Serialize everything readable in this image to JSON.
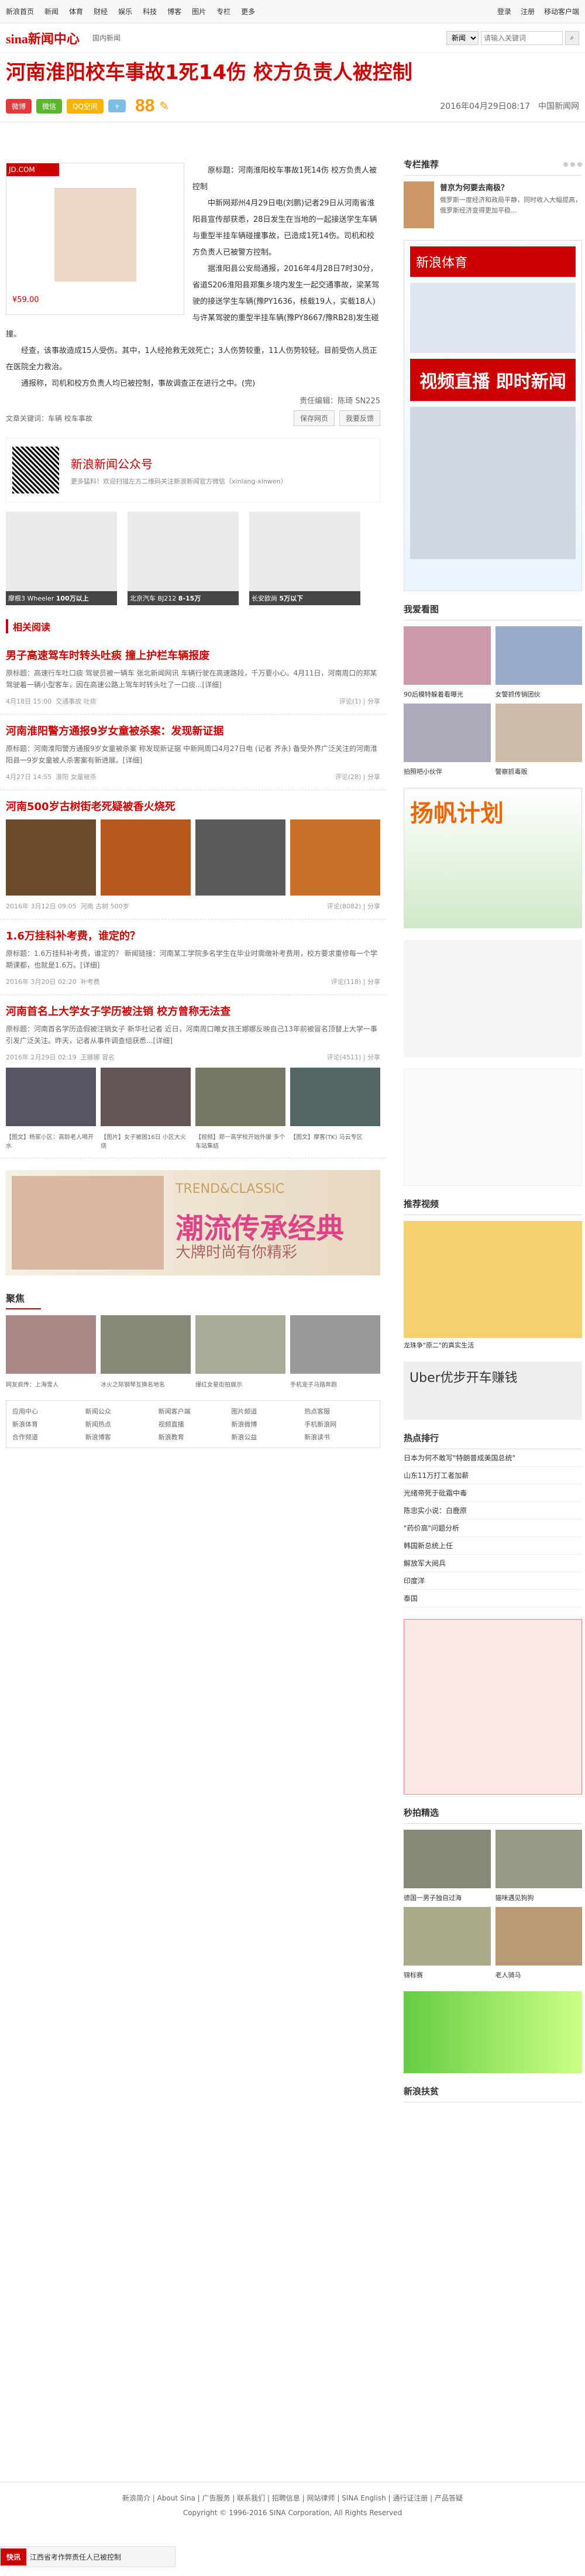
{
  "topbar": {
    "nav": [
      "新浪首页",
      "新闻",
      "体育",
      "财经",
      "娱乐",
      "科技",
      "博客",
      "图片",
      "专栏",
      "更多"
    ],
    "login": "登录",
    "register": "注册",
    "mobile": "移动客户端"
  },
  "header": {
    "logo": "sina新闻中心",
    "crumb": "国内新闻",
    "search_sel": "新闻",
    "search_ph": "请输入关键词"
  },
  "article": {
    "title": "河南淮阳校车事故1死14伤 校方负责人被控制",
    "share": [
      "微博",
      "微信",
      "QQ空间",
      "+"
    ],
    "heat": "88",
    "date": "2016年04月29日08:17",
    "source": "中国新闻网",
    "paras": [
      "原标题：河南淮阳校车事故1死14伤 校方负责人被控制",
      "中新网郑州4月29日电(刘鹏)记者29日从河南省淮阳县宣传部获悉，28日发生在当地的一起接送学生车辆与重型半挂车辆碰撞事故，已造成1死14伤。司机和校方负责人已被警方控制。",
      "据淮阳县公安局通报，2016年4月28日7时30分，省道S206淮阳县郑集乡境内发生一起交通事故，梁某驾驶的接送学生车辆(豫PY1636，核载19人，实载18人)与许某驾驶的重型半挂车辆(豫PY8667/豫RB28)发生碰撞。",
      "经查，该事故造成15人受伤。其中，1人经抢救无效死亡；3人伤势较重，11人伤势较轻。目前受伤人员正在医院全力救治。",
      "通报称，司机和校方负责人均已被控制，事故调查正在进行之中。(完)"
    ],
    "editor": "责任编辑：陈琦 SN225",
    "keywords": "文章关键词：车辆 校车事故",
    "save": "保存网页",
    "feedback": "我要反馈"
  },
  "wx": {
    "title": "新浪新闻公众号",
    "sub": "更多猛料！欢迎扫描左方二维码关注新浪新闻官方微信（xinlang-xinwen）"
  },
  "cars": [
    {
      "cap": "摩根3 Wheeler",
      "price": "100万以上"
    },
    {
      "cap": "北京汽车 BJ212",
      "price": "8-15万"
    },
    {
      "cap": "长安欧尚",
      "price": "5万以下"
    }
  ],
  "related": {
    "head": "相关阅读",
    "items": [
      {
        "title": "男子高速驾车时转头吐痰 撞上护栏车辆报废",
        "desc": "原标题：高速行车吐口痰 驾驶员被一辆车 张北新闻网讯 车辆行驶在高速路段，千万要小心。4月11日，河南周口的郑某驾驶着一辆小型客车，因在高速公路上驾车时转头吐了一口痰...[详细]",
        "date": "4月18日 15:00",
        "src": "交通事故 吐痰",
        "cmt": "评论(1) | 分享"
      },
      {
        "title": "河南淮阳警方通报9岁女童被杀案：发现新证据",
        "desc": "原标题：河南淮阳警方通报9岁女童被杀案 称发现新证据 中新网周口4月27日电 (记者 齐永) 备受外界广泛关注的河南淮阳县一9岁女童被人杀害案有新进展。[详细]",
        "date": "4月27日 14:55",
        "src": "淮阳 女童被杀",
        "cmt": "评论(28) | 分享"
      },
      {
        "title": "河南500岁古树街老死疑被香火烧死",
        "desc": "",
        "date": "2016年 3月12日 09:05",
        "src": "河南 古树 500岁",
        "cmt": "评论(8082) | 分享"
      },
      {
        "title": "1.6万挂科补考费，谁定的？",
        "desc": "原标题：1.6万挂科补考费，谁定的？ 新闻链接：河南某工学院多名学生在毕业时需缴补考费用，校方要求重修每一个学期课都，也就是1.6万。[详细]",
        "date": "2016年 3月20日 02:20",
        "src": "补考费",
        "cmt": "评论(118) | 分享"
      },
      {
        "title": "河南首名上大学女子学历被注销 校方曾称无法查",
        "desc": "原标题：河南首名学历造假被注销女子 新华社记者 近日，河南周口睢女孩王娜娜反映自己13年前被冒名顶替上大学一事引发广泛关注。昨天，记者从事件调查组获悉...[详细]",
        "date": "2016年 2月29日 02:19",
        "src": "王娜娜 冒名",
        "cmt": "评论(4511) | 分享"
      }
    ]
  },
  "pics_caps": [
    "【图文】杨家小区：高龄老人喝开水",
    "【图片】女子被困16日 小区大火烧",
    "【视频】郑一高学校开始外援 多个车站集结",
    "【图文】摩客(TK) 马云专区"
  ],
  "adwide": {
    "t1": "TREND&CLASSIC",
    "t2": "潮流传承经典",
    "t3": "大牌时尚有你精彩"
  },
  "jx": {
    "head": "聚焦",
    "caps": [
      "网友疯传：上海雪人",
      "冰火之际钢琴互换名地名",
      "爆红女星街拍展示",
      "手机宠子马路奔跑"
    ]
  },
  "footlinks": [
    "应用中心",
    "新闻公众",
    "新闻客户端",
    "图片频道",
    "热点客服",
    "新浪体育",
    "新闻热点",
    "视频直播",
    "新浪微博",
    "手机新浪网",
    "合作频道",
    "新浪博客",
    "新浪教育",
    "新浪公益",
    "新浪读书"
  ],
  "side": {
    "rec_head": "专栏推荐",
    "rec_title": "普京为何要去南极？",
    "rec_desc": "俄罗斯一度经济和政局平静，同时收入大幅提高，俄罗斯经济变得更加平稳...",
    "ad_a": "新浪体育",
    "ad_b": "视频直播 即时新闻",
    "like_head": "我爱看图",
    "like_caps": [
      "90后模特躲着看曝光",
      "女警抓传销团伙",
      "拍照吧小伙伴",
      "警察抓毒贩"
    ],
    "ad2": "扬帆计划",
    "video_head": "推荐视频",
    "video_cap": "龙珠争\"原二\"的真实生活",
    "hot_head": "热点排行",
    "hot": [
      "日本为何不敢写\"特朗普成美国总统\"",
      "山东11万打工者加薪",
      "光绪帝死于砒霜中毒",
      "陈忠实小说：白鹿原",
      "\"药价高\"问题分析",
      "韩国新总统上任",
      "解放军大阅兵",
      "印度洋",
      "泰国"
    ],
    "seconds_head": "秒拍精选",
    "seconds_caps": [
      "德国一男子独自过海",
      "猫咪遇见狗狗",
      "锦标赛",
      "老人骑马"
    ],
    "news_head": "新浪扶贫",
    "uber": "Uber优步开车赚钱"
  },
  "bottom": {
    "links": "新浪简介 | About Sina | 广告服务 | 联系我们 | 招聘信息 | 网站律师 | SINA English | 通行证注册 | 产品答疑",
    "copy": "Copyright © 1996-2016 SINA Corporation, All Rights Reserved"
  },
  "float": {
    "k": "快讯",
    "t": "江西省考作弊责任人已被控制"
  }
}
